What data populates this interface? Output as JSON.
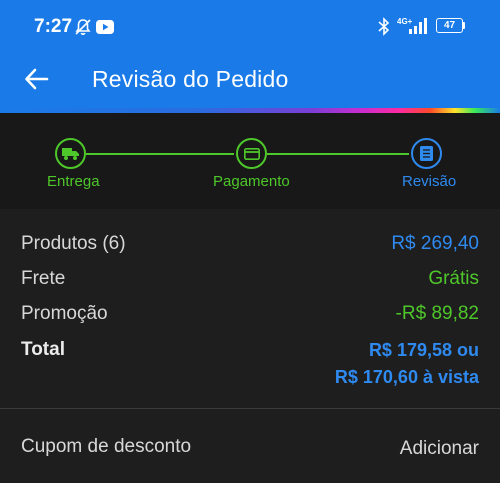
{
  "status_bar": {
    "time": "7:27",
    "network": "4G+",
    "battery": "47"
  },
  "header": {
    "title": "Revisão do Pedido"
  },
  "stepper": {
    "steps": [
      {
        "label": "Entrega",
        "icon": "truck-icon",
        "state": "done"
      },
      {
        "label": "Pagamento",
        "icon": "credit-card-icon",
        "state": "done"
      },
      {
        "label": "Revisão",
        "icon": "receipt-icon",
        "state": "current"
      }
    ]
  },
  "summary": {
    "products": {
      "label": "Produtos (6)",
      "value": "R$ 269,40"
    },
    "shipping": {
      "label": "Frete",
      "value": "Grátis"
    },
    "promotion": {
      "label": "Promoção",
      "value": "-R$ 89,82"
    },
    "total": {
      "label": "Total",
      "value_line1": "R$ 179,58 ou",
      "value_line2": "R$ 170,60 à vista"
    }
  },
  "coupon": {
    "label": "Cupom de desconto",
    "action": "Adicionar"
  },
  "colors": {
    "primary": "#1a7be8",
    "success": "#4ec72a",
    "accent_blue": "#2f8af0",
    "background": "#1e1e1e"
  }
}
